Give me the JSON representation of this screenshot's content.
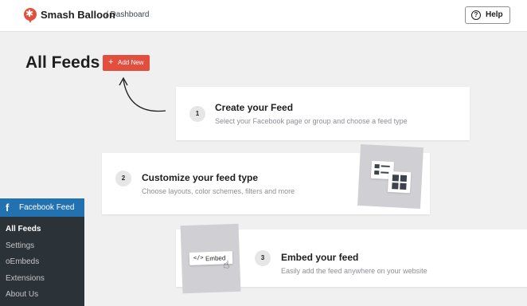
{
  "header": {
    "brand": "Smash Balloon",
    "breadcrumb": "/ Dashboard",
    "help_label": "Help",
    "help_icon": "question-circle-icon"
  },
  "main": {
    "title": "All Feeds",
    "add_new_label": "Add New",
    "accent_color": "#e34f3f"
  },
  "steps": [
    {
      "number": "1",
      "title": "Create your Feed",
      "description": "Select your Facebook page or group and choose a feed type"
    },
    {
      "number": "2",
      "title": "Customize your feed type",
      "description": "Choose layouts, color schemes, filters and more"
    },
    {
      "number": "3",
      "title": "Embed your feed",
      "description": "Easily add the feed anywhere on your website"
    }
  ],
  "embed_illustration": {
    "code_glyph": "</>",
    "label": "Embed"
  },
  "sidebar": {
    "menu_title": "Facebook Feed",
    "menu_color": "#2271b1",
    "items": [
      {
        "label": "All Feeds",
        "current": true
      },
      {
        "label": "Settings",
        "current": false
      },
      {
        "label": "oEmbeds",
        "current": false
      },
      {
        "label": "Extensions",
        "current": false
      },
      {
        "label": "About Us",
        "current": false
      }
    ]
  }
}
